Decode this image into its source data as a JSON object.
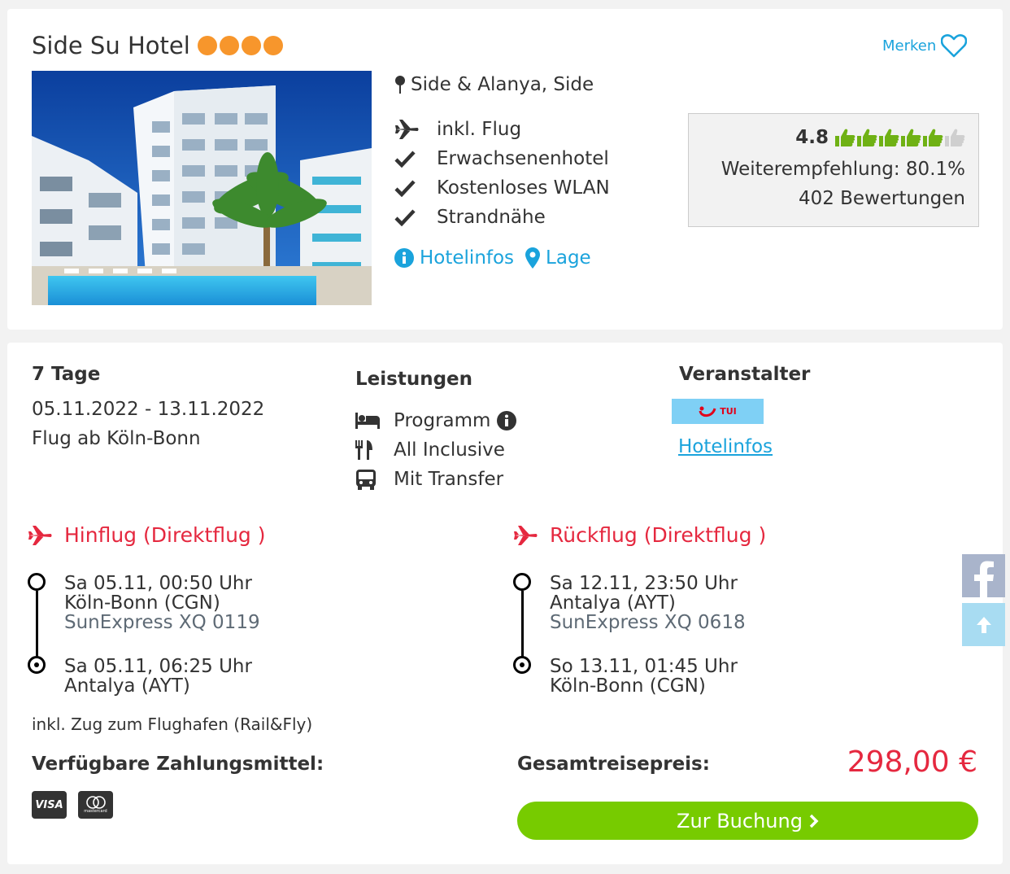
{
  "hotel": {
    "name": "Side Su Hotel",
    "stars": 4,
    "merken_label": "Merken",
    "location": "Side & Alanya, Side",
    "features": [
      "inkl. Flug",
      "Erwachsenenhotel",
      "Kostenloses WLAN",
      "Strandnähe"
    ],
    "feature_icons": [
      "plane-icon",
      "check-icon",
      "check-icon",
      "check-icon"
    ],
    "links": {
      "hotelinfos": "Hotelinfos",
      "lage": "Lage"
    },
    "image": "hotel-photo"
  },
  "rating": {
    "score": "4.8",
    "thumbs_filled": 5,
    "thumbs_total": 6,
    "recommendation": "Weiterempfehlung: 80.1%",
    "count": "402 Bewertungen"
  },
  "trip": {
    "duration": "7 Tage",
    "dates": "05.11.2022 - 13.11.2022",
    "departure": "Flug ab Köln-Bonn"
  },
  "leistungen": {
    "title": "Leistungen",
    "items": [
      {
        "label": "Programm",
        "icon": "bed-icon"
      },
      {
        "label": "All Inclusive",
        "icon": "cutlery-icon"
      },
      {
        "label": "Mit Transfer",
        "icon": "bus-icon"
      }
    ]
  },
  "veranstalter": {
    "title": "Veranstalter",
    "logo": "TUI",
    "link": "Hotelinfos"
  },
  "hinflug": {
    "title": "Hinflug (Direktflug )",
    "departure": {
      "time": "Sa 05.11, 00:50 Uhr",
      "airport": "Köln-Bonn (CGN)",
      "airline": "SunExpress XQ 0119"
    },
    "arrival": {
      "time": "Sa 05.11, 06:25 Uhr",
      "airport": "Antalya (AYT)"
    }
  },
  "rueckflug": {
    "title": "Rückflug (Direktflug )",
    "departure": {
      "time": "Sa 12.11, 23:50 Uhr",
      "airport": "Antalya (AYT)",
      "airline": "SunExpress XQ 0618"
    },
    "arrival": {
      "time": "So 13.11, 01:45 Uhr",
      "airport": "Köln-Bonn (CGN)"
    }
  },
  "rail_note": "inkl. Zug zum Flughafen (Rail&Fly)",
  "payment": {
    "title": "Verfügbare Zahlungsmittel:",
    "methods": [
      "VISA",
      "mastercard"
    ]
  },
  "total": {
    "label": "Gesamtreisepreis:",
    "price": "298,00 €"
  },
  "booking_button": "Zur Buchung",
  "colors": {
    "accent_blue": "#1aa3dc",
    "price_red": "#e5283f",
    "star_orange": "#f7962c",
    "book_green": "#77cb00",
    "thumb_green": "#6fb114"
  }
}
